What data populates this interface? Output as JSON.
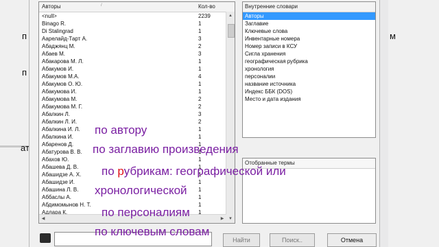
{
  "authors": {
    "header_author": "Авторы",
    "header_count": "Кол-во",
    "rows": [
      {
        "name": "<null>",
        "count": "2239"
      },
      {
        "name": "Binago R.",
        "count": "1"
      },
      {
        "name": "Di Stalingrad",
        "count": "1"
      },
      {
        "name": "Аарелайд-Тарт А.",
        "count": "3"
      },
      {
        "name": "Абаджянц М.",
        "count": "2"
      },
      {
        "name": "Абаев М.",
        "count": "3"
      },
      {
        "name": "Абакарова М. Л.",
        "count": "1"
      },
      {
        "name": "Абакумов И.",
        "count": "1"
      },
      {
        "name": "Абакумов М.А.",
        "count": "4"
      },
      {
        "name": "Абакумов О. Ю.",
        "count": "1"
      },
      {
        "name": "Абакумова И.",
        "count": "1"
      },
      {
        "name": "Абакумова М.",
        "count": "2"
      },
      {
        "name": "Абакумова М. Г.",
        "count": "2"
      },
      {
        "name": "Абалкин Л.",
        "count": "3"
      },
      {
        "name": "Абалкин Л. И.",
        "count": "2"
      },
      {
        "name": "Абалкина И. Л.",
        "count": "1"
      },
      {
        "name": "Абалкина И.",
        "count": "1"
      },
      {
        "name": "Абаренов Д.",
        "count": "1"
      },
      {
        "name": "Абатурова В. В.",
        "count": "1"
      },
      {
        "name": "Абахов Ю.",
        "count": "1"
      },
      {
        "name": "Абашева Д. В.",
        "count": "1"
      },
      {
        "name": "Абашидзе А. Х.",
        "count": "1"
      },
      {
        "name": "Абашидзе И.",
        "count": "1"
      },
      {
        "name": "Абашина Л. В.",
        "count": "1"
      },
      {
        "name": "Аббаслы А.",
        "count": "1"
      },
      {
        "name": "Абдимомынов Н. Т.",
        "count": "1"
      },
      {
        "name": "Адлара К.",
        "count": "1"
      }
    ]
  },
  "vocabularies": {
    "header": "Внутренние словари",
    "items": [
      "Авторы",
      "Заглавие",
      "Ключевые слова",
      "Инвентарные номера",
      "Номер записи в КСУ",
      "Сигла хранения",
      "географическая рубрика",
      "хронология",
      "персоналии",
      "название источника",
      "Индекс ББК (DOS)",
      "Место и дата издания"
    ],
    "selected_index": 0
  },
  "selected_terms": {
    "header": "Отобранные термы"
  },
  "buttons": {
    "find": "Найти",
    "search": "Поиск..",
    "cancel": "Отмена"
  },
  "bg_fragments": {
    "left_top": "п",
    "left_mid": "п",
    "left_low": "ат",
    "right_top": "м"
  },
  "overlay": {
    "line1": "по автору",
    "line2": "по заглавию произведения",
    "line3_prefix": "по ",
    "line3_red": "р",
    "line3_rest": "убрикам: географической или",
    "line4": "хронологической",
    "line5": "по персоналиям",
    "line6": "по ключевым словам"
  }
}
